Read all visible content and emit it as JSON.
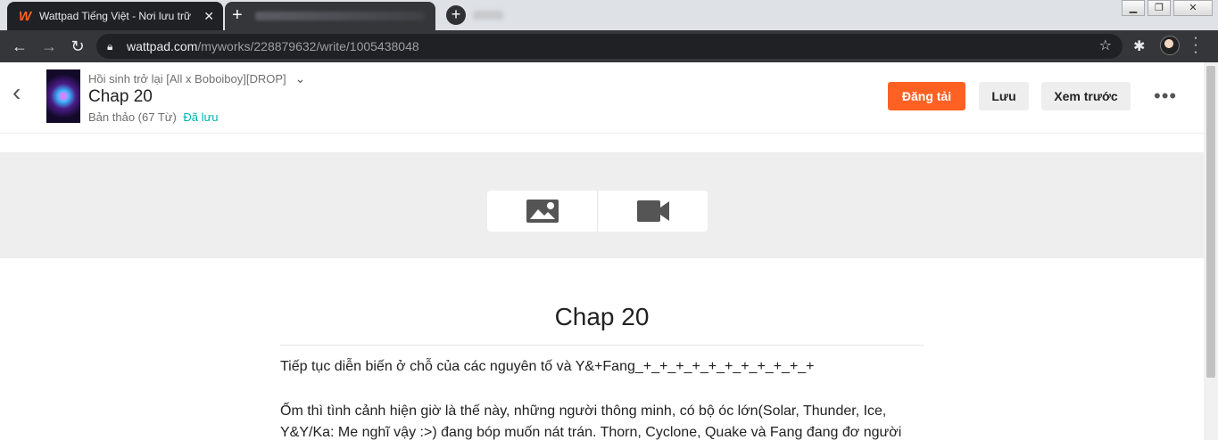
{
  "browser": {
    "active_tab": {
      "title": "Wattpad Tiếng Việt - Nơi lưu trữ",
      "favicon": "W"
    },
    "url": {
      "host": "wattpad.com",
      "path": "/myworks/228879632/write/1005438048"
    }
  },
  "editor": {
    "story_title": "Hồi sinh trở lại [All x Boboiboy][DROP]",
    "chapter_title": "Chap 20",
    "status": "Bản thảo (67 Từ)",
    "saved": "Đã lưu",
    "actions": {
      "publish": "Đăng tải",
      "save": "Lưu",
      "preview": "Xem trước"
    },
    "more": "•••"
  },
  "document": {
    "title": "Chap 20",
    "paragraphs": [
      "Tiếp tục diễn biến ở chỗ của các nguyên tố và Y&+Fang_+_+_+_+_+_+_+_+_+_+_+",
      "Ốm thì tình cảnh hiện giờ là thế này, những người thông minh, có bộ óc lớn(Solar, Thunder, Ice, Y&Y/Ka: Me nghĩ vậy :>) đang bóp muốn nát trán. Thorn, Cyclone, Quake và Fang đang đơ người"
    ]
  },
  "colors": {
    "accent": "#ff6122",
    "saved": "#00b2b2"
  }
}
